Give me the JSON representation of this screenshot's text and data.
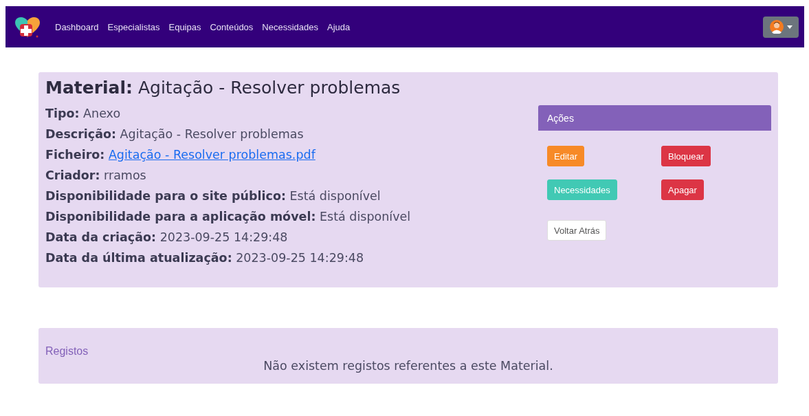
{
  "navbar": {
    "links": [
      "Dashboard",
      "Especialistas",
      "Equipas",
      "Conteúdos",
      "Necessidades",
      "Ajuda"
    ]
  },
  "material": {
    "title_label": "Material:",
    "title": "Agitação - Resolver problemas",
    "fields": [
      {
        "label": "Tipo:",
        "value": "Anexo",
        "kind": "text"
      },
      {
        "label": "Descrição:",
        "value": "Agitação - Resolver problemas",
        "kind": "text"
      },
      {
        "label": "Ficheiro:",
        "value": "Agitação - Resolver problemas.pdf",
        "kind": "link"
      },
      {
        "label": "Criador:",
        "value": "rramos",
        "kind": "text"
      },
      {
        "label": "Disponibilidade para o site público:",
        "value": "Está disponível",
        "kind": "text"
      },
      {
        "label": "Disponibilidade para a aplicação móvel:",
        "value": "Está disponível",
        "kind": "text"
      },
      {
        "label": "Data da criação:",
        "value": "2023-09-25 14:29:48",
        "kind": "text"
      },
      {
        "label": "Data da última atualização:",
        "value": "2023-09-25 14:29:48",
        "kind": "text"
      }
    ],
    "actions": {
      "title": "Ações",
      "rows": [
        [
          {
            "label": "Editar",
            "kind": "warning"
          },
          {
            "label": "Bloquear",
            "kind": "danger"
          }
        ],
        [
          {
            "label": "Necessidades",
            "kind": "info"
          },
          {
            "label": "Apagar",
            "kind": "danger"
          }
        ],
        [
          {
            "label": "Voltar Atrás",
            "kind": "light"
          }
        ]
      ]
    }
  },
  "records": {
    "title": "Registos",
    "empty_message": "Não existem registos referentes a este Material."
  }
}
